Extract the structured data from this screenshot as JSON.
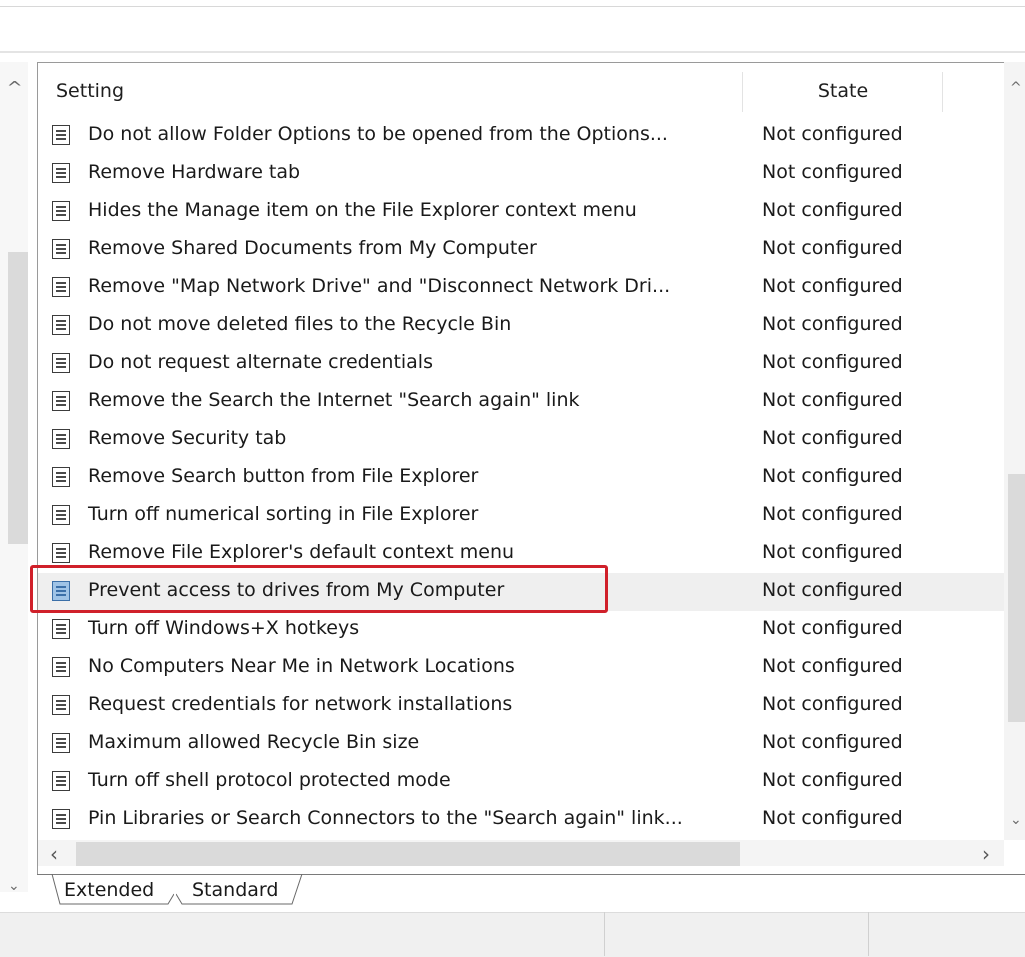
{
  "header": {
    "setting_label": "Setting",
    "state_label": "State"
  },
  "rows": [
    {
      "name": "Do not allow Folder Options to be opened from the Options...",
      "state": "Not configured"
    },
    {
      "name": "Remove Hardware tab",
      "state": "Not configured"
    },
    {
      "name": "Hides the Manage item on the File Explorer context menu",
      "state": "Not configured"
    },
    {
      "name": "Remove Shared Documents from My Computer",
      "state": "Not configured"
    },
    {
      "name": "Remove \"Map Network Drive\" and \"Disconnect Network Dri...",
      "state": "Not configured"
    },
    {
      "name": "Do not move deleted files to the Recycle Bin",
      "state": "Not configured"
    },
    {
      "name": "Do not request alternate credentials",
      "state": "Not configured"
    },
    {
      "name": "Remove the Search the Internet \"Search again\" link",
      "state": "Not configured"
    },
    {
      "name": "Remove Security tab",
      "state": "Not configured"
    },
    {
      "name": "Remove Search button from File Explorer",
      "state": "Not configured"
    },
    {
      "name": "Turn off numerical sorting in File Explorer",
      "state": "Not configured"
    },
    {
      "name": "Remove File Explorer's default context menu",
      "state": "Not configured"
    },
    {
      "name": "Prevent access to drives from My Computer",
      "state": "Not configured",
      "selected": true
    },
    {
      "name": "Turn off Windows+X hotkeys",
      "state": "Not configured"
    },
    {
      "name": "No Computers Near Me in Network Locations",
      "state": "Not configured"
    },
    {
      "name": "Request credentials for network installations",
      "state": "Not configured"
    },
    {
      "name": "Maximum allowed Recycle Bin size",
      "state": "Not configured"
    },
    {
      "name": "Turn off shell protocol protected mode",
      "state": "Not configured"
    },
    {
      "name": "Pin Libraries or Search Connectors to the \"Search again\" link...",
      "state": "Not configured"
    }
  ],
  "tabs": [
    {
      "label": "Extended",
      "active": false
    },
    {
      "label": "Standard",
      "active": true
    }
  ],
  "icons": {
    "policy": "policy-setting-icon",
    "scroll_up": "scroll-up-arrow-icon",
    "scroll_down": "scroll-down-arrow-icon",
    "scroll_left": "scroll-left-arrow-icon",
    "scroll_right": "scroll-right-arrow-icon"
  },
  "colors": {
    "highlight_box": "#d0202a",
    "selected_row": "#efefef",
    "selected_icon": "#9fc3e6"
  }
}
